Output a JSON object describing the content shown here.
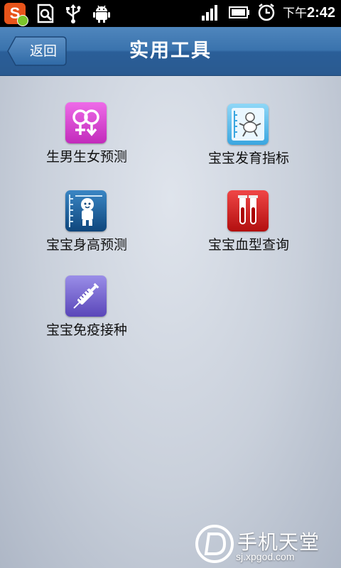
{
  "status_bar": {
    "time_prefix": "下午",
    "time": "2:42",
    "icons": [
      "sogou-input-icon",
      "sd-card-icon",
      "usb-icon",
      "android-debug-icon",
      "signal-icon",
      "battery-icon",
      "alarm-icon"
    ]
  },
  "header": {
    "back_label": "返回",
    "title": "实用工具"
  },
  "tools": [
    {
      "label": "生男生女预测",
      "icon": "gender-symbols-icon",
      "color": "#d83fcf"
    },
    {
      "label": "宝宝发育指标",
      "icon": "baby-measurement-icon",
      "color": "#58b8ea"
    },
    {
      "label": "宝宝身高预测",
      "icon": "height-ruler-icon",
      "color": "#1b5b93"
    },
    {
      "label": "宝宝血型查询",
      "icon": "blood-test-tubes-icon",
      "color": "#cc1a1a"
    },
    {
      "label": "宝宝免疫接种",
      "icon": "syringe-icon",
      "color": "#6a58c7"
    }
  ],
  "watermark": {
    "name": "手机天堂",
    "url": "sj.xpgod.com"
  }
}
